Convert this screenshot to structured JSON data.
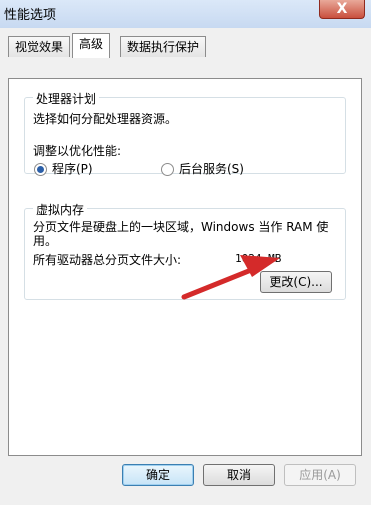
{
  "window": {
    "title": "性能选项",
    "close_glyph": "X"
  },
  "tabs": [
    {
      "label": "视觉效果"
    },
    {
      "label": "高级"
    },
    {
      "label": "数据执行保护"
    }
  ],
  "processor": {
    "legend": "处理器计划",
    "description": "选择如何分配处理器资源。",
    "optimize_label": "调整以优化性能:",
    "options": [
      {
        "label": "程序(P)",
        "selected": true
      },
      {
        "label": "后台服务(S)",
        "selected": false
      }
    ]
  },
  "virtual_memory": {
    "legend": "虚拟内存",
    "description_line1": "分页文件是硬盘上的一块区域，Windows 当作 RAM 使",
    "description_line2": "用。",
    "total_label": "所有驱动器总分页文件大小:",
    "total_value": "1024 MB",
    "change_button": "更改(C)..."
  },
  "footer": {
    "ok": "确定",
    "cancel": "取消",
    "apply": "应用(A)"
  },
  "colors": {
    "annotation_arrow": "#d42a2a"
  }
}
